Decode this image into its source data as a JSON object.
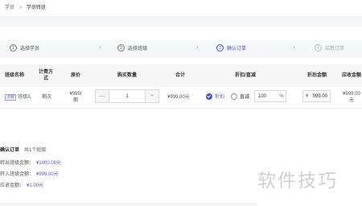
{
  "breadcrumb": {
    "parent": "学员",
    "current": "学员转班"
  },
  "steps": [
    {
      "num": "1",
      "label": "选择学员"
    },
    {
      "num": "2",
      "label": "选择班级"
    },
    {
      "num": "3",
      "label": "确认订单"
    },
    {
      "num": "4",
      "label": "结算订单"
    }
  ],
  "table": {
    "headers": {
      "class_name": "班级名称",
      "billing": "计费方式",
      "price": "原价",
      "quantity": "购买数量",
      "total": "合计",
      "discount": "折扣/直减",
      "discounted": "折后金额",
      "receivable": "应收金额"
    },
    "row": {
      "tag": "法税",
      "class_name": "班级A",
      "billing": "期次",
      "price": "¥999/期",
      "quantity": "1",
      "total": "¥999.00元",
      "discount_option": "折扣",
      "direct_option": "直减",
      "discount_value": "100",
      "discount_unit": "%",
      "currency": "¥",
      "discounted_amount": "999.00",
      "receivable": "¥999.00元"
    }
  },
  "summary": {
    "title": "确认订单",
    "count": "共1个班级",
    "out_label": "转出班级金额：",
    "out_amount": "¥1000.00元",
    "in_label": "转入班级金额：",
    "in_amount": "¥999.00元",
    "refund_label": "应退金额：",
    "refund_amount": "¥1.00元"
  },
  "watermark": "软件技巧",
  "colors": {
    "accent": "#4a55c8",
    "step_bar": "#f5f7fb",
    "header_bg": "#f7f7f7"
  },
  "icons": {
    "step_arrow": "chevron-right-icon",
    "radio_checked": "radio-checked-icon"
  }
}
